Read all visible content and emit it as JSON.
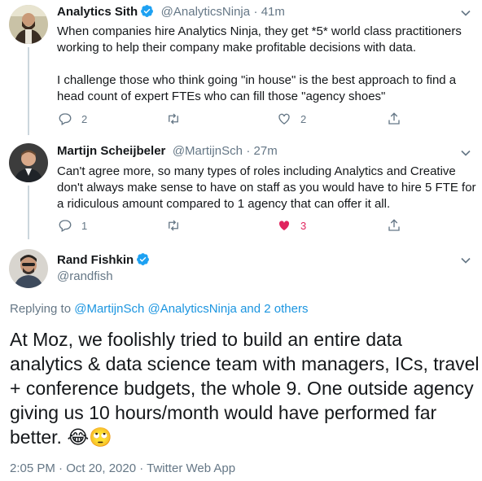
{
  "tweets": [
    {
      "name": "Analytics Sith",
      "handle": "@AnalyticsNinja",
      "time": "· 41m",
      "lines": [
        "When companies hire Analytics Ninja, they get *5* world class practitioners",
        "working to help their company make profitable decisions with data.",
        "",
        "I challenge those who think going \"in house\" is the best approach to find a",
        "head count of expert FTEs who can fill those \"agency shoes\""
      ],
      "replies": "2",
      "likes": "2"
    },
    {
      "name": "Martijn Scheijbeler",
      "handle": "@MartijnSch",
      "time": "· 27m",
      "lines": [
        "Can't agree more, so many types of roles including Analytics and Creative",
        "don't always make sense to have on staff as you would have to hire 5 FTE for",
        "a ridiculous amount compared to 1 agency that can offer it all."
      ],
      "replies": "1",
      "likes": "3"
    }
  ],
  "main": {
    "name": "Rand Fishkin",
    "handle": "@randfish",
    "replying_prefix": "Replying to ",
    "replying_to": "@MartijnSch @AnalyticsNinja and 2 others",
    "lines": [
      "At Moz, we foolishly tried to build an entire data",
      "analytics & data science team with managers, ICs, travel",
      "+ conference budgets, the whole 9. One outside agency",
      "giving us 10 hours/month would have performed far",
      "better."
    ],
    "emoji": "😂🙄",
    "meta": "2:05 PM · Oct 20, 2020 · Twitter Web App"
  },
  "colors": {
    "accent": "#1da1f2",
    "like": "#e0245e",
    "muted": "#657786"
  }
}
